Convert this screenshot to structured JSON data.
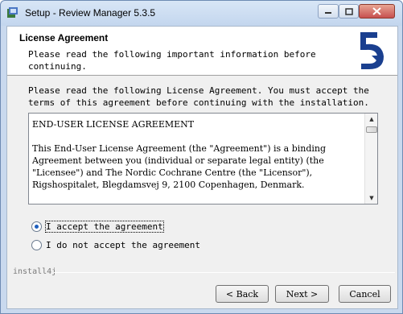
{
  "window": {
    "title": "Setup - Review Manager 5.3.5",
    "icons": {
      "app": "setup-icon",
      "minimize": "minimize-icon",
      "maximize": "maximize-icon",
      "close": "close-icon"
    }
  },
  "header": {
    "title": "License Agreement",
    "subtitle": "Please read the following important information before continuing.",
    "logo": "install4j-logo-icon"
  },
  "intro": "Please read the following License Agreement. You must accept the terms of this agreement before continuing with the installation.",
  "license": {
    "heading": "END-USER LICENSE AGREEMENT",
    "paragraph": "This End-User License Agreement (the \"Agreement\") is a binding Agreement between you (individual or separate legal entity) (the \"Licensee\") and The Nordic Cochrane Centre (the \"Licensor\"), Rigshospitalet, Blegdamsvej 9, 2100 Copenhagen, Denmark."
  },
  "options": {
    "accept": {
      "label": "I accept the agreement",
      "selected": true
    },
    "decline": {
      "label": "I do not accept the agreement",
      "selected": false
    }
  },
  "brand": "install4j",
  "buttons": {
    "back": "< Back",
    "next": "Next >",
    "cancel": "Cancel"
  },
  "colors": {
    "accent": "#1e5fbe",
    "logo_blue": "#1a3f8f"
  }
}
